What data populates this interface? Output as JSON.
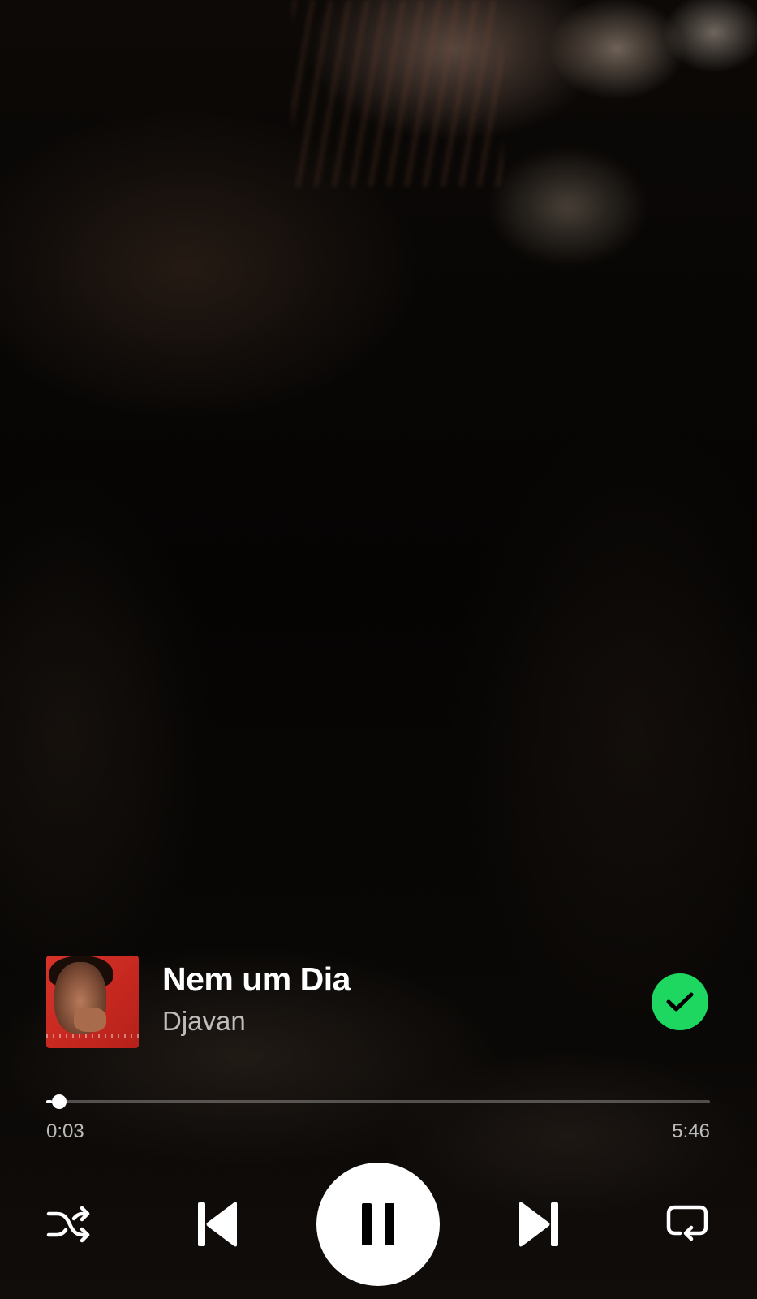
{
  "track": {
    "title": "Nem um Dia",
    "artist": "Djavan",
    "liked": true
  },
  "playback": {
    "elapsed": "0:03",
    "total": "5:46",
    "progress_fraction": 0.009,
    "state": "playing"
  },
  "controls": {
    "shuffle_icon": "shuffle-icon",
    "previous_icon": "skip-back-icon",
    "play_pause_icon": "pause-icon",
    "next_icon": "skip-forward-icon",
    "repeat_icon": "repeat-icon"
  },
  "colors": {
    "accent": "#1ed760",
    "text_primary": "#ffffff",
    "text_secondary": "rgba(255,255,255,0.72)",
    "cover_background": "#d8342c"
  }
}
